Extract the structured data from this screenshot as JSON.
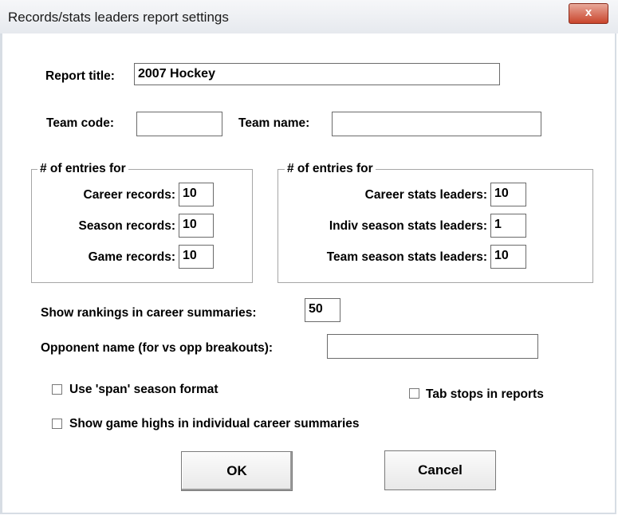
{
  "window": {
    "title": "Records/stats leaders report settings",
    "close_glyph": "x"
  },
  "report_title": {
    "label": "Report title:",
    "value": "2007 Hockey"
  },
  "team_code": {
    "label": "Team code:",
    "value": ""
  },
  "team_name": {
    "label": "Team name:",
    "value": ""
  },
  "records_group": {
    "legend": "# of entries for",
    "items": [
      {
        "label": "Career records:",
        "value": "10"
      },
      {
        "label": "Season records:",
        "value": "10"
      },
      {
        "label": "Game records:",
        "value": "10"
      }
    ]
  },
  "stats_group": {
    "legend": "# of entries for",
    "items": [
      {
        "label": "Career stats leaders:",
        "value": "10"
      },
      {
        "label": "Indiv season stats leaders:",
        "value": "1"
      },
      {
        "label": "Team season stats leaders:",
        "value": "10"
      }
    ]
  },
  "rankings": {
    "label": "Show rankings in career summaries:",
    "value": "50"
  },
  "opponent": {
    "label": "Opponent name (for vs opp breakouts):",
    "value": ""
  },
  "checkboxes": {
    "span_format": {
      "label": "Use 'span' season format",
      "checked": false
    },
    "tab_stops": {
      "label": "Tab stops in reports",
      "checked": false
    },
    "game_highs": {
      "label": "Show game highs in individual career summaries",
      "checked": false
    }
  },
  "buttons": {
    "ok": "OK",
    "cancel": "Cancel"
  }
}
